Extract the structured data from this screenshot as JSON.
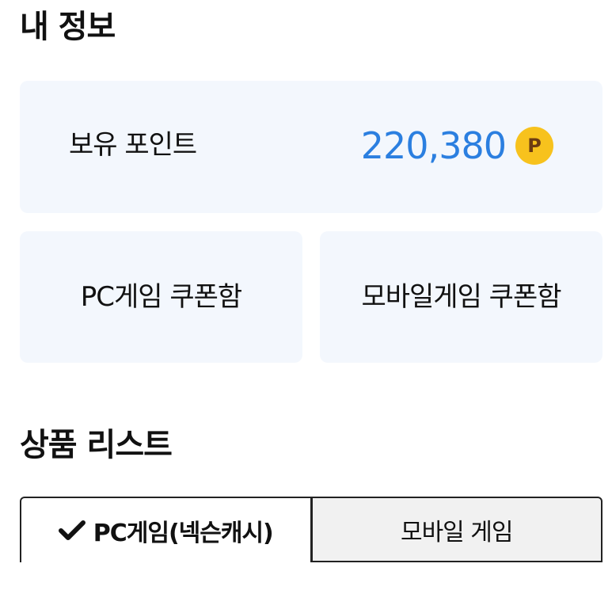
{
  "my_info": {
    "title": "내 정보",
    "points": {
      "label": "보유 포인트",
      "value": "220,380",
      "coin_symbol": "P",
      "value_color": "#2b7fe0",
      "coin_color": "#f7c21d"
    },
    "coupons": {
      "pc_label": "PC게임 쿠폰함",
      "mobile_label": "모바일게임 쿠폰함"
    }
  },
  "products": {
    "title": "상품 리스트",
    "tabs": [
      {
        "label": "PC게임(넥슨캐시)",
        "selected": true,
        "icon": "checkmark-icon"
      },
      {
        "label": "모바일 게임",
        "selected": false
      }
    ]
  }
}
